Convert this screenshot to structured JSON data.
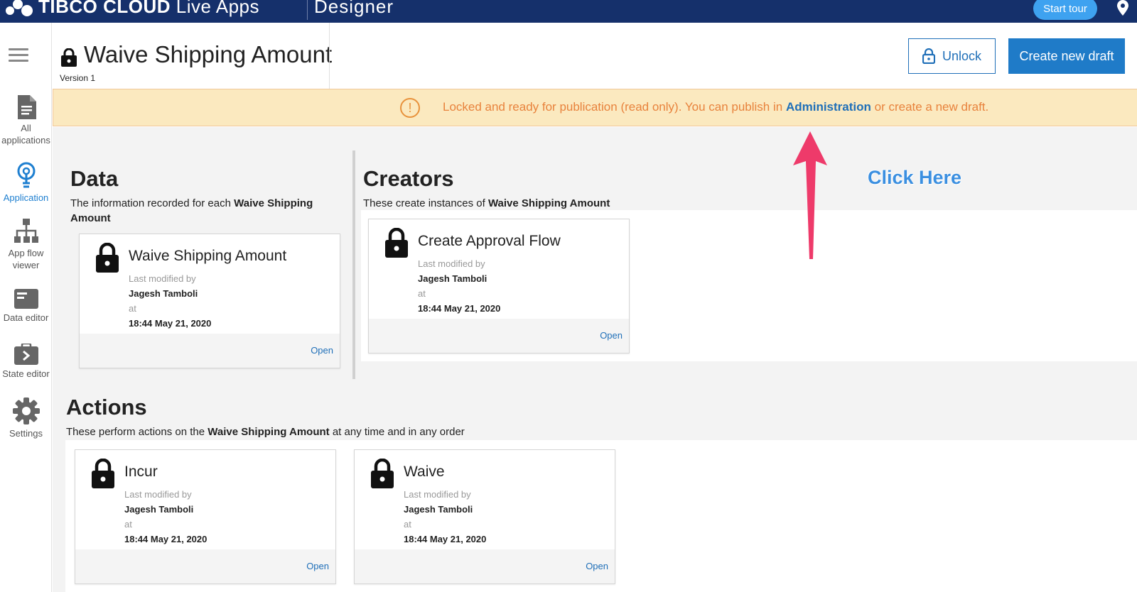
{
  "topbar": {
    "brand_strong": "TIBCO CLOUD",
    "brand_light": " Live Apps",
    "designer": "Designer",
    "start_tour": "Start tour"
  },
  "sidebar": {
    "items": [
      {
        "label_line1": "All",
        "label_line2": "applications",
        "icon": "document-icon"
      },
      {
        "label_line1": "Application",
        "label_line2": "",
        "icon": "lightbulb-icon"
      },
      {
        "label_line1": "App flow",
        "label_line2": "viewer",
        "icon": "flow-icon"
      },
      {
        "label_line1": "Data editor",
        "label_line2": "",
        "icon": "data-editor-icon"
      },
      {
        "label_line1": "State editor",
        "label_line2": "",
        "icon": "state-editor-icon"
      },
      {
        "label_line1": "Settings",
        "label_line2": "",
        "icon": "gear-icon"
      }
    ]
  },
  "header": {
    "title": "Waive Shipping Amount",
    "version": "Version 1",
    "unlock_label": "Unlock",
    "create_label": "Create new draft"
  },
  "banner": {
    "text_before": "Locked and ready for publication (read only). You can publish in ",
    "link": "Administration",
    "text_after": " or create a new draft."
  },
  "data_section": {
    "title": "Data",
    "desc_before": "The information recorded for each ",
    "desc_bold": "Waive Shipping Amount",
    "card": {
      "name": "Waive Shipping Amount",
      "modified_label": "Last modified by",
      "user": "Jagesh Tamboli",
      "at_label": "at",
      "time": "18:44 May 21, 2020",
      "open": "Open"
    }
  },
  "creators_section": {
    "title": "Creators",
    "desc_before": "These create instances of ",
    "desc_bold": "Waive Shipping Amount",
    "card": {
      "name": "Create Approval Flow",
      "modified_label": "Last modified by",
      "user": "Jagesh Tamboli",
      "at_label": "at",
      "time": "18:44 May 21, 2020",
      "open": "Open"
    }
  },
  "actions_section": {
    "title": "Actions",
    "desc_before": "These perform actions on the ",
    "desc_bold": "Waive Shipping Amount",
    "desc_after": " at any time and in any order",
    "cards": [
      {
        "name": "Incur",
        "modified_label": "Last modified by",
        "user": "Jagesh Tamboli",
        "at_label": "at",
        "time": "18:44 May 21, 2020",
        "open": "Open"
      },
      {
        "name": "Waive",
        "modified_label": "Last modified by",
        "user": "Jagesh Tamboli",
        "at_label": "at",
        "time": "18:44 May 21, 2020",
        "open": "Open"
      }
    ]
  },
  "annotation": {
    "text": "Click Here",
    "color": "#3b8fe0",
    "arrow_color": "#ee3a6a"
  }
}
